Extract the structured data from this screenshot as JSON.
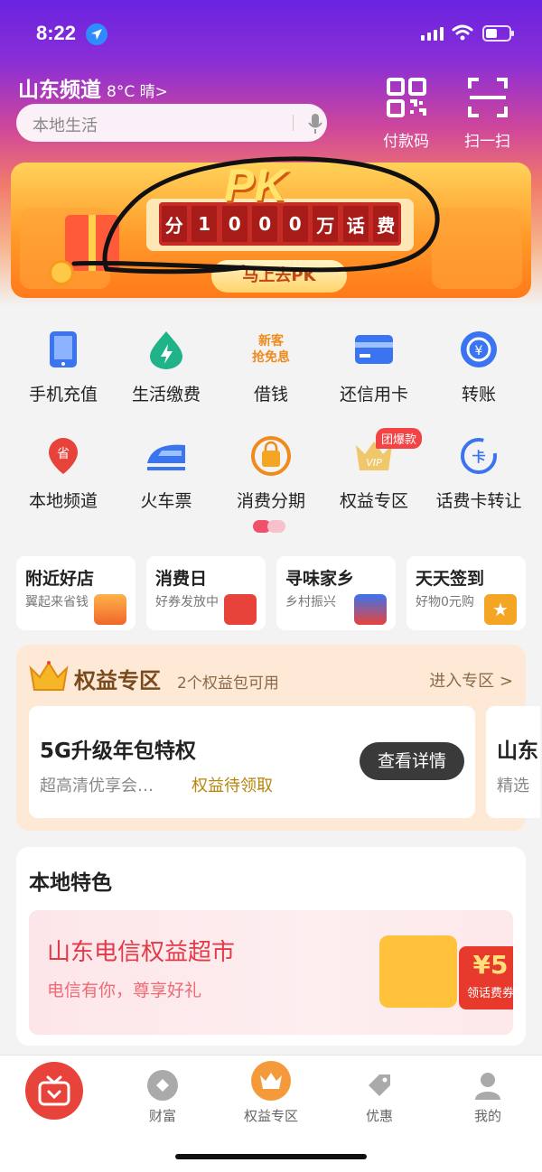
{
  "status_bar": {
    "time": "8:22"
  },
  "header": {
    "city": "山东频道",
    "weather": "8°C 晴>",
    "search_placeholder": "本地生活",
    "pay_code_label": "付款码",
    "scan_label": "扫一扫"
  },
  "banner": {
    "title": "PK",
    "board_chars": [
      "分",
      "1",
      "0",
      "0",
      "0",
      "万",
      "话",
      "费"
    ],
    "cta": "马上去PK"
  },
  "grid": {
    "items": [
      {
        "label": "手机充值",
        "icon": "phone-icon"
      },
      {
        "label": "生活缴费",
        "icon": "drop-bolt-icon"
      },
      {
        "label": "借钱",
        "icon": "new-customer-icon",
        "icon_text": [
          "新客",
          "抢免息"
        ]
      },
      {
        "label": "还信用卡",
        "icon": "credit-card-icon"
      },
      {
        "label": "转账",
        "icon": "transfer-icon"
      },
      {
        "label": "本地频道",
        "icon": "local-province-icon",
        "icon_text": "省"
      },
      {
        "label": "火车票",
        "icon": "train-icon"
      },
      {
        "label": "消费分期",
        "icon": "shopping-bag-icon"
      },
      {
        "label": "权益专区",
        "icon": "vip-crown-icon",
        "icon_text": "VIP"
      },
      {
        "label": "话费卡转让",
        "icon": "card-transfer-icon",
        "icon_text": "卡"
      }
    ],
    "hot_badge": "团爆款"
  },
  "quick_cards": [
    {
      "title": "附近好店",
      "subtitle": "翼起来省钱"
    },
    {
      "title": "消费日",
      "subtitle": "好券发放中"
    },
    {
      "title": "寻味家乡",
      "subtitle": "乡村振兴"
    },
    {
      "title": "天天签到",
      "subtitle": "好物0元购"
    }
  ],
  "rights": {
    "title": "权益专区",
    "subtitle": "2个权益包可用",
    "enter": "进入专区 >",
    "card": {
      "title": "5G升级年包特权",
      "desc": "超高清优享会…",
      "claim": "权益待领取",
      "button": "查看详情"
    },
    "card2": {
      "title": "山东",
      "desc": "精选"
    }
  },
  "local": {
    "heading": "本地特色",
    "card_title": "山东电信权益超市",
    "card_subtitle": "电信有你，尊享好礼",
    "coupon_value": "¥5",
    "coupon_label": "领话费券"
  },
  "tabbar": {
    "items": [
      {
        "label": "财富"
      },
      {
        "label": "权益专区"
      },
      {
        "label": "优惠"
      },
      {
        "label": "我的"
      }
    ]
  }
}
